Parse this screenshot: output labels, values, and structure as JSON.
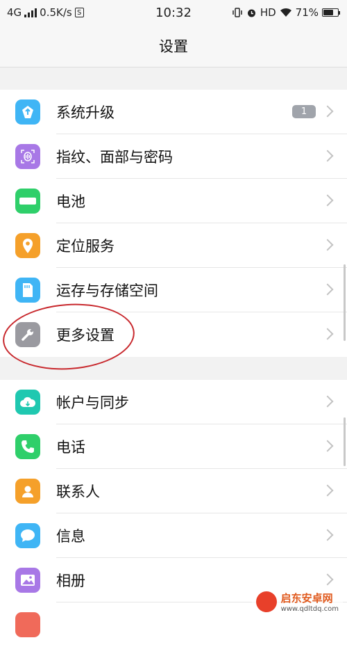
{
  "status_bar": {
    "network": "4G",
    "speed": "0.5K/s",
    "s_icon": "S",
    "time": "10:32",
    "hd": "HD",
    "battery": "71%",
    "battery_level": 0.71
  },
  "header": {
    "title": "设置"
  },
  "group1": [
    {
      "label": "系统升级",
      "icon": "system-update-icon",
      "color": "#3fb5f5",
      "badge": "1"
    },
    {
      "label": "指纹、面部与密码",
      "icon": "fingerprint-icon",
      "color": "#a878e6"
    },
    {
      "label": "电池",
      "icon": "battery-icon",
      "color": "#2fcf6a"
    },
    {
      "label": "定位服务",
      "icon": "location-icon",
      "color": "#f5a02a"
    },
    {
      "label": "运存与存储空间",
      "icon": "storage-icon",
      "color": "#3fb5f5"
    },
    {
      "label": "更多设置",
      "icon": "wrench-icon",
      "color": "#9a9aa0"
    }
  ],
  "group2": [
    {
      "label": "帐户与同步",
      "icon": "cloud-sync-icon",
      "color": "#1fc8b0"
    },
    {
      "label": "电话",
      "icon": "phone-icon",
      "color": "#2fcf6a"
    },
    {
      "label": "联系人",
      "icon": "contacts-icon",
      "color": "#f5a02a"
    },
    {
      "label": "信息",
      "icon": "message-icon",
      "color": "#3fb5f5"
    },
    {
      "label": "相册",
      "icon": "album-icon",
      "color": "#a878e6"
    },
    {
      "label": "",
      "icon": "partial-icon",
      "color": "#f06a5a"
    }
  ],
  "watermark": {
    "title": "启东安卓网",
    "url": "www.qdltdq.com"
  },
  "colors": {
    "annotation_circle": "#c8282d"
  }
}
